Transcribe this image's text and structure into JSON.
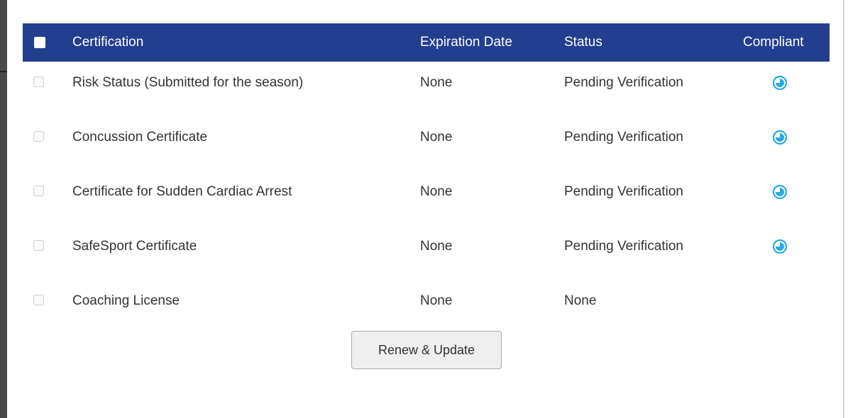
{
  "table": {
    "headers": {
      "certification": "Certification",
      "expiration_date": "Expiration Date",
      "status": "Status",
      "compliant": "Compliant"
    },
    "rows": [
      {
        "certification": "Risk Status (Submitted for the season)",
        "expiration_date": "None",
        "status": "Pending Verification",
        "compliant_icon": "pending-clock-icon"
      },
      {
        "certification": "Concussion Certificate",
        "expiration_date": "None",
        "status": "Pending Verification",
        "compliant_icon": "pending-clock-icon"
      },
      {
        "certification": "Certificate for Sudden Cardiac Arrest",
        "expiration_date": "None",
        "status": "Pending Verification",
        "compliant_icon": "pending-clock-icon"
      },
      {
        "certification": "SafeSport Certificate",
        "expiration_date": "None",
        "status": "Pending Verification",
        "compliant_icon": "pending-clock-icon"
      },
      {
        "certification": "Coaching License",
        "expiration_date": "None",
        "status": "None",
        "compliant_icon": ""
      }
    ]
  },
  "actions": {
    "renew_label": "Renew & Update"
  },
  "colors": {
    "header_bg": "#223e8f",
    "header_text": "#ffffff",
    "pending_icon": "#2aaae0",
    "body_text": "#333333"
  }
}
